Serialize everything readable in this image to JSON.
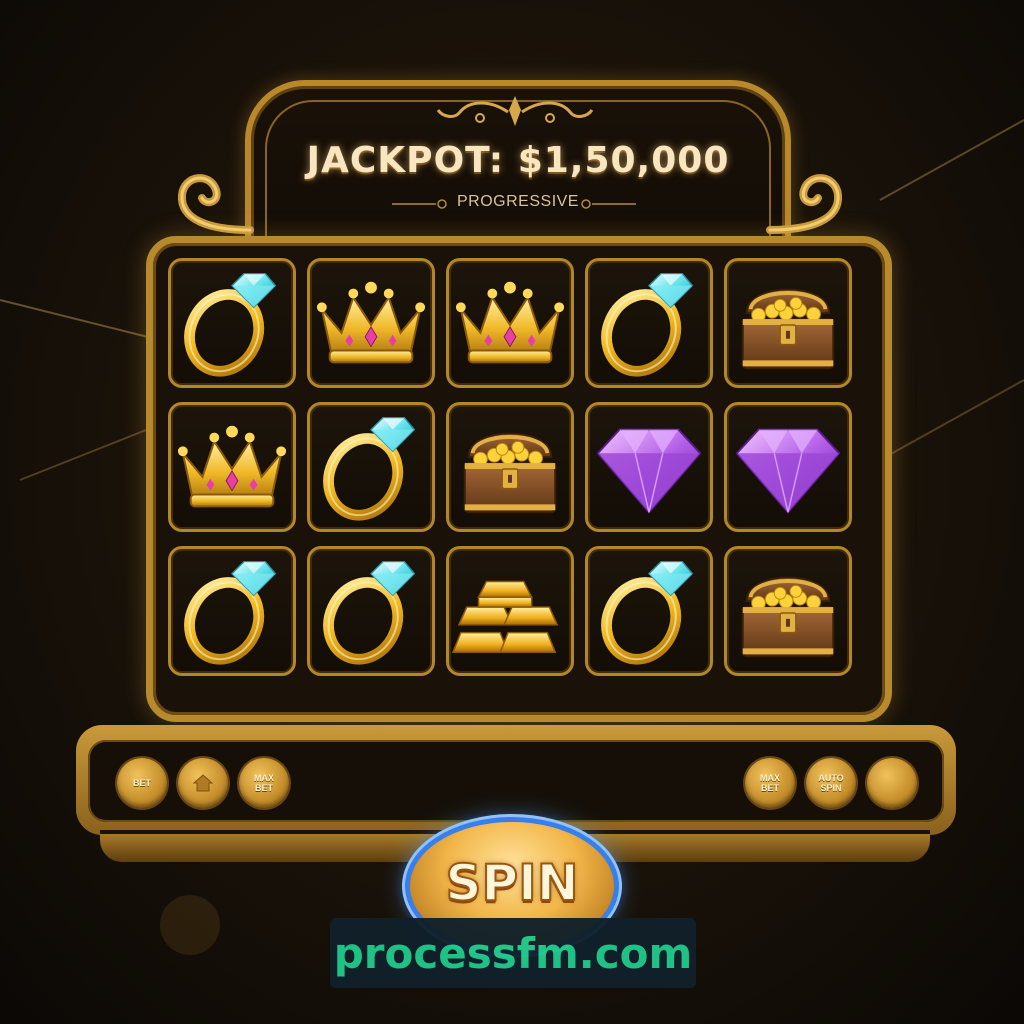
{
  "jackpot": {
    "title": "JACKPOT: $1,50,000",
    "subtitle": "PROGRESSIVE"
  },
  "reels": [
    [
      "diamond-ring",
      "gold-crown",
      "gold-crown",
      "diamond-ring",
      "treasure-chest"
    ],
    [
      "gold-crown",
      "diamond-ring",
      "treasure-chest",
      "purple-gem",
      "purple-gem"
    ],
    [
      "diamond-ring",
      "diamond-ring",
      "gold-bars",
      "diamond-ring",
      "treasure-chest"
    ]
  ],
  "controls": {
    "bet_label": "BET",
    "home_icon": "home-icon",
    "max_bet_left": "MAX\nBET",
    "max_bet_right": "MAX\nBET",
    "auto_spin": "AUTO\nSPIN",
    "blank_icon": "blank-button"
  },
  "spin_label": "SPIN",
  "watermark": "processfm.com",
  "colors": {
    "gold": "#b9882a",
    "background": "#1c140a",
    "spin_glow": "#3a7ee8",
    "watermark_text": "#20c98a"
  }
}
